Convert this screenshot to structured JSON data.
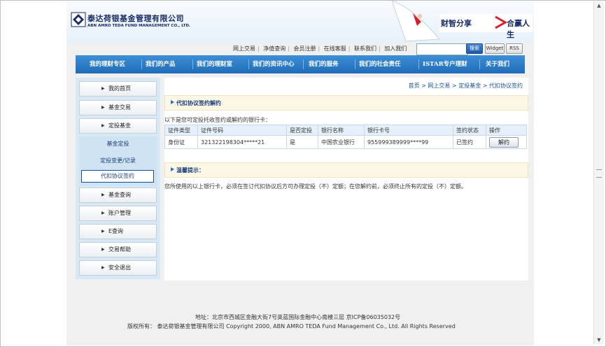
{
  "header": {
    "logo_cn": "泰达荷银基金管理有限公司",
    "logo_en": "ABN AMRO TEDA FUND MANAGEMENT CO., LTD.",
    "slogan_left": "财智分享",
    "slogan_right": "合赢人生"
  },
  "toplinks": [
    "网上交易",
    "净值查询",
    "会员注册",
    "在线客服",
    "联系我们",
    "加入我们"
  ],
  "search": {
    "value": "",
    "button": "搜索"
  },
  "widget_label": "Widget",
  "rss_label": "RSS",
  "nav": [
    "我的理财专区",
    "我们的产品",
    "我们的理财室",
    "我们的资讯中心",
    "我们的服务",
    "我们的社会责任",
    "ISTAR专户理财",
    "关于我们"
  ],
  "sidebar": {
    "top_items": [
      "我的首页",
      "基金交易",
      "定投基金"
    ],
    "sub_items": [
      "基金定投",
      "定投变更/记录",
      "代扣协议签约"
    ],
    "bottom_items": [
      "基金查询",
      "账户管理",
      "E查询",
      "交易帮助",
      "安全退出"
    ]
  },
  "breadcrumb": "首页 > 网上交易 > 定投基金 > 代扣协议签约",
  "section_title": "代扣协议签约解约",
  "intro": "以下是您可定投托收签约或解约的银行卡：",
  "table": {
    "headers": [
      "证件类型",
      "证件号码",
      "是否定投",
      "银行名称",
      "银行卡号",
      "签约状态",
      "操作"
    ],
    "rows": [
      [
        "身份证",
        "321322198304*****21",
        "是",
        "中国农业银行",
        "955999389999****99",
        "已签约",
        "解约"
      ]
    ]
  },
  "notice_title": "温馨提示：",
  "notice_text": "您所使用的以上银行卡，必须在签订代扣协议后方可办理定投（不）定额；在您解约前，必须终止所有的定投（不）定额。",
  "footer": {
    "address": "地址：北京市西城区金融大街7号英蓝国际金融中心南楼三层 京ICP备06035032号",
    "copyright": "版权所有：  泰达荷银基金管理有限公司  Copyright 2000, ABN AMRO TEDA Fund Management Co., Ltd. All Rights Reserved"
  },
  "colors": {
    "nav": "#2a7cc9",
    "sidebar": "#d8e9f6",
    "title": "#1b3f7a"
  }
}
